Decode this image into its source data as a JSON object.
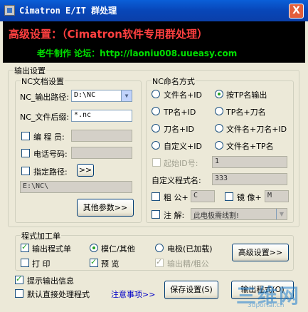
{
  "window": {
    "title": "Cimatron E/IT 群处理",
    "close_label": "X"
  },
  "banner": {
    "title": "高级设置：（Cimatron软件专用群处理）",
    "subtitle": "老牛制作 论坛：http://laoniu008.uueasy.com"
  },
  "output_settings": {
    "label": "输出设置",
    "nc_doc": {
      "label": "NC文档设置",
      "path_label": "NC_输出路径:",
      "path_value": "D:\\NC",
      "suffix_label": "NC_文件后缀:",
      "suffix_value": "*.nc",
      "programmer_label": "编 程 员:",
      "programmer_value": "",
      "phone_label": "电话号码:",
      "phone_value": "",
      "custom_path_label": "指定路径:",
      "browse_label": ">>",
      "path_display": "E:\\NC\\",
      "other_params_label": "其他参数>>"
    },
    "nc_naming": {
      "label": "NC命名方式",
      "options": [
        "文件名+ID",
        "按TP名输出",
        "TP名+ID",
        "TP名+刀名",
        "刀名+ID",
        "文件名+刀名+ID",
        "自定义+ID",
        "文件名+TP名"
      ],
      "start_id_label": "起始ID号:",
      "start_id_value": "1",
      "custom_name_label": "自定义程式名:",
      "custom_name_value": "333",
      "rough_label": "粗 公+",
      "rough_value": "C",
      "mirror_label": "镜 像+",
      "mirror_value": "M",
      "note_label": "注 解:",
      "note_value": "此电极需线割!"
    }
  },
  "program_sheet": {
    "label": "程式加工单",
    "output_sheet_label": "输出程式单",
    "mold_label": "模仁/其他",
    "electrode_label": "电极(已加载)",
    "print_label": "打 印",
    "preview_label": "预 览",
    "output_precision_label": "输出精/粗公",
    "advanced_label": "高级设置>>"
  },
  "footer": {
    "show_info_label": "提示输出信息",
    "default_process_label": "默认直接处理程式",
    "notes_label": "注意事项>>",
    "save_label": "保存设置(S)",
    "output_label": "输出程式(O)"
  },
  "watermark": {
    "text": "三维网",
    "sub": "3dportal.cn"
  }
}
